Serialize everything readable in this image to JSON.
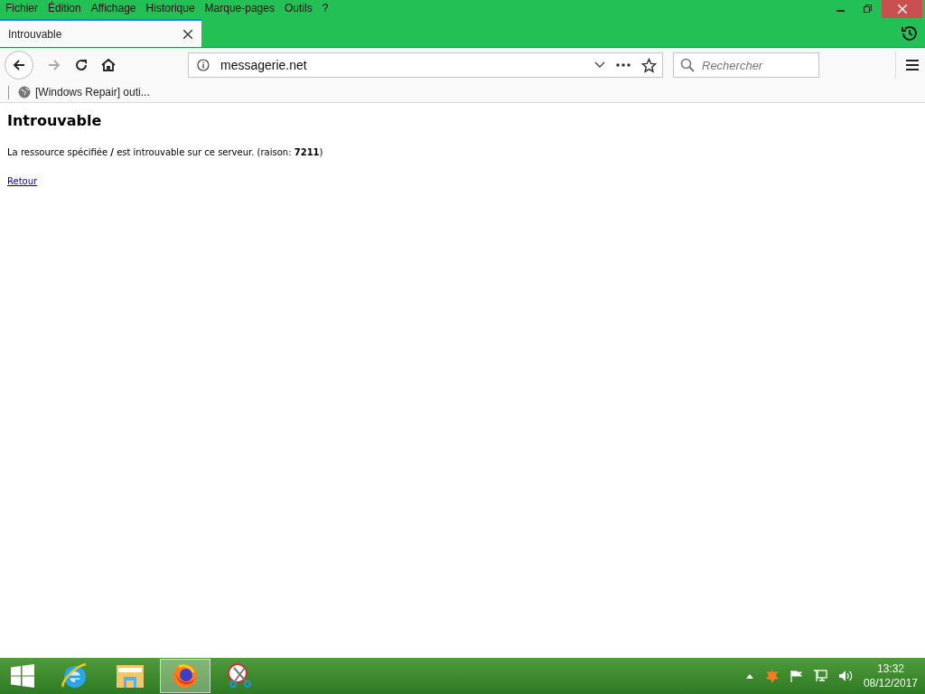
{
  "menu_bar": {
    "items": [
      "Fichier",
      "Édition",
      "Affichage",
      "Historique",
      "Marque-pages",
      "Outils",
      "?"
    ]
  },
  "tabs": [
    {
      "title": "Introuvable",
      "selected": true
    }
  ],
  "url_bar": {
    "value": "messagerie.net"
  },
  "search": {
    "placeholder": "Rechercher"
  },
  "bookmarks": [
    {
      "label": "[Windows Repair] outi..."
    }
  ],
  "page": {
    "heading": "Introuvable",
    "message": "La ressource spécifiée **/** est introuvable sur ce serveur. (raison: **7211**)",
    "link": "Retour"
  },
  "taskbar": {
    "apps": [
      {
        "kind": "browser-e",
        "selected": false
      },
      {
        "kind": "folder",
        "selected": false
      },
      {
        "kind": "firefox",
        "selected": true
      },
      {
        "kind": "scissors",
        "selected": false
      }
    ],
    "time": "13:32",
    "date": "08/12/2017"
  }
}
